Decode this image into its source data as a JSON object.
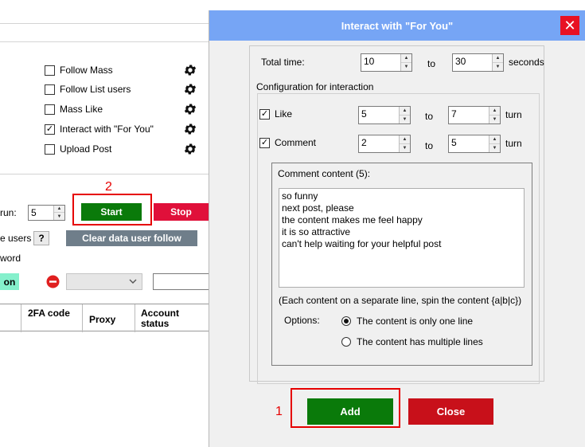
{
  "background_app": {
    "options": [
      {
        "label": "Follow Mass",
        "checked": false,
        "icon": "gear-icon"
      },
      {
        "label": "Follow List users",
        "checked": false,
        "icon": "gear-icon"
      },
      {
        "label": "Mass Like",
        "checked": false,
        "icon": "gear-icon"
      },
      {
        "label": "Interact with \"For You\"",
        "checked": true,
        "icon": "gear-icon"
      },
      {
        "label": "Upload Post",
        "checked": false,
        "icon": "gear-icon"
      }
    ],
    "run_label": "run:",
    "run_value": "5",
    "start_label": "Start",
    "stop_label": "Stop",
    "users_label": "e users",
    "help_label": "?",
    "clear_label": "Clear data user follow",
    "word_label": "word",
    "on_label": "on",
    "table_headers": [
      "2FA code",
      "Proxy",
      "Account status"
    ],
    "step2_label": "2",
    "colors": {
      "start": "#0a7a0a",
      "stop": "#e0103a",
      "clear": "#6f7e8a",
      "on": "#85f0cc"
    }
  },
  "dialog": {
    "title": "Interact with \"For You\"",
    "close_icon": "close-icon",
    "total_time_label": "Total time:",
    "total_from": "10",
    "to_label": "to",
    "total_to": "30",
    "seconds_label": "seconds",
    "config_legend": "Configuration for interaction",
    "like_label": "Like",
    "like_checked": true,
    "like_from": "5",
    "like_to": "7",
    "turn_label": "turn",
    "comment_label": "Comment",
    "comment_checked": true,
    "comment_from": "2",
    "comment_to": "5",
    "content_legend": "Comment content (5):",
    "comments": [
      "so funny",
      "next post, please",
      "the content makes me feel happy",
      "it is so attractive",
      "can't help waiting for your helpful post"
    ],
    "hint": "(Each content on a separate line, spin the content {a|b|c})",
    "options_label": "Options:",
    "option_one_line": "The content is only one line",
    "option_multi_line": "The content has multiple lines",
    "selected_option": "one_line",
    "add_label": "Add",
    "close_label": "Close",
    "step1_label": "1",
    "colors": {
      "title_bar": "#76a5f5",
      "add": "#0a7a0a",
      "close": "#c8101a",
      "highlight": "#e60000"
    }
  }
}
